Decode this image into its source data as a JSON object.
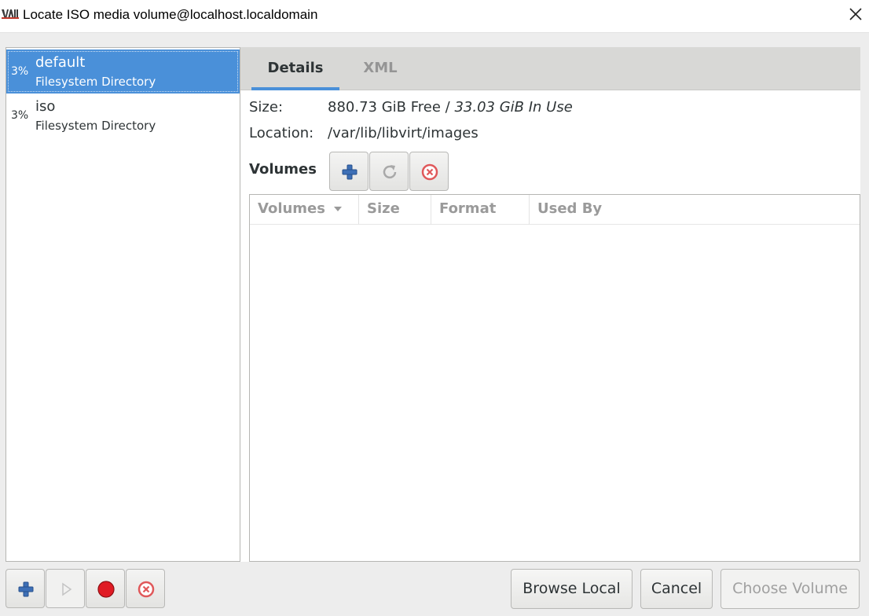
{
  "window": {
    "title": "Locate ISO media volume@localhost.localdomain",
    "logo_icon": "virt-manager-logo-icon",
    "close_icon": "close-icon"
  },
  "pools": [
    {
      "percent": "3%",
      "name": "default",
      "type": "Filesystem Directory",
      "selected": true
    },
    {
      "percent": "3%",
      "name": "iso",
      "type": "Filesystem Directory",
      "selected": false
    }
  ],
  "tabs": {
    "details": "Details",
    "xml": "XML"
  },
  "details": {
    "size_label": "Size:",
    "free": "880.73 GiB Free",
    "separator": " / ",
    "in_use": "33.03 GiB In Use",
    "location_label": "Location:",
    "location_value": "/var/lib/libvirt/images",
    "volumes_heading": "Volumes"
  },
  "volume_table": {
    "columns": [
      "Volumes",
      "Size",
      "Format",
      "Used By"
    ],
    "sort_indicator": "sort-desc-icon",
    "rows": []
  },
  "buttons": {
    "browse_local": "Browse Local",
    "cancel": "Cancel",
    "choose_volume": "Choose Volume"
  },
  "colors": {
    "selection": "#4a90d9",
    "add_icon": "#3d6fb6",
    "delete_icon": "#e0585a",
    "stop_icon": "#e01b24"
  }
}
